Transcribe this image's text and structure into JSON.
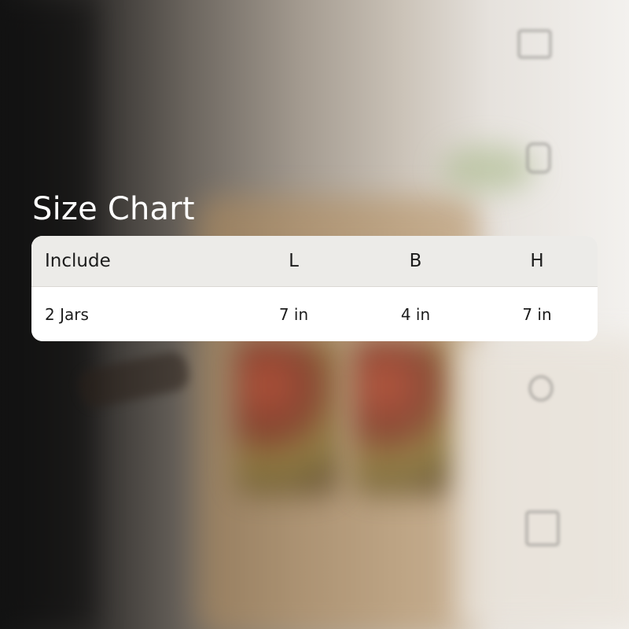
{
  "title": "Size Chart",
  "table": {
    "headers": [
      "Include",
      "L",
      "B",
      "H"
    ],
    "rows": [
      [
        "2 Jars",
        "7 in",
        "4 in",
        "7 in"
      ]
    ]
  },
  "colors": {
    "title_text": "#ffffff",
    "header_bg": "#ecebe8",
    "row_bg": "#ffffff",
    "cell_text": "#1c1c1c"
  }
}
